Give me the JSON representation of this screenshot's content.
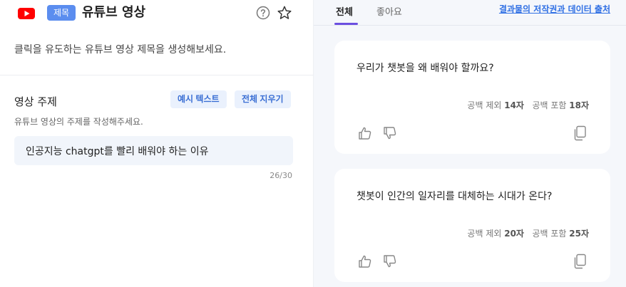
{
  "header": {
    "category_badge": "제목",
    "title": "유튜브 영상",
    "icons": [
      "youtube-logo",
      "help-icon",
      "star-icon"
    ]
  },
  "description": "클릭을 유도하는 유튜브 영상 제목을 생성해보세요.",
  "topic_field": {
    "label": "영상 주제",
    "example_button": "예시 텍스트",
    "clear_button": "전체 지우기",
    "hint": "유튜브 영상의 주제를 작성해주세요.",
    "value": "인공지능 chatgpt를 빨리 배워야 하는 이유",
    "char_count": "26/30"
  },
  "results": {
    "tabs": [
      {
        "label": "전체",
        "active": true
      },
      {
        "label": "좋아요",
        "active": false
      }
    ],
    "report_link": "결과물의 저작권과 데이터 출처",
    "cards": [
      {
        "text": "우리가 챗봇을 왜 배워야 할까요?",
        "stat_no_space_label": "공백 제외",
        "stat_no_space_value": "14자",
        "stat_with_space_label": "공백 포함",
        "stat_with_space_value": "18자"
      },
      {
        "text": "챗봇이 인간의 일자리를 대체하는 시대가 온다?",
        "stat_no_space_label": "공백 제외",
        "stat_no_space_value": "20자",
        "stat_with_space_label": "공백 포함",
        "stat_with_space_value": "25자"
      }
    ]
  },
  "colors": {
    "accent_purple": "#6b4fe0",
    "badge_blue": "#5b8def",
    "link_blue": "#2f6fe4",
    "youtube_red": "#ff0000"
  }
}
